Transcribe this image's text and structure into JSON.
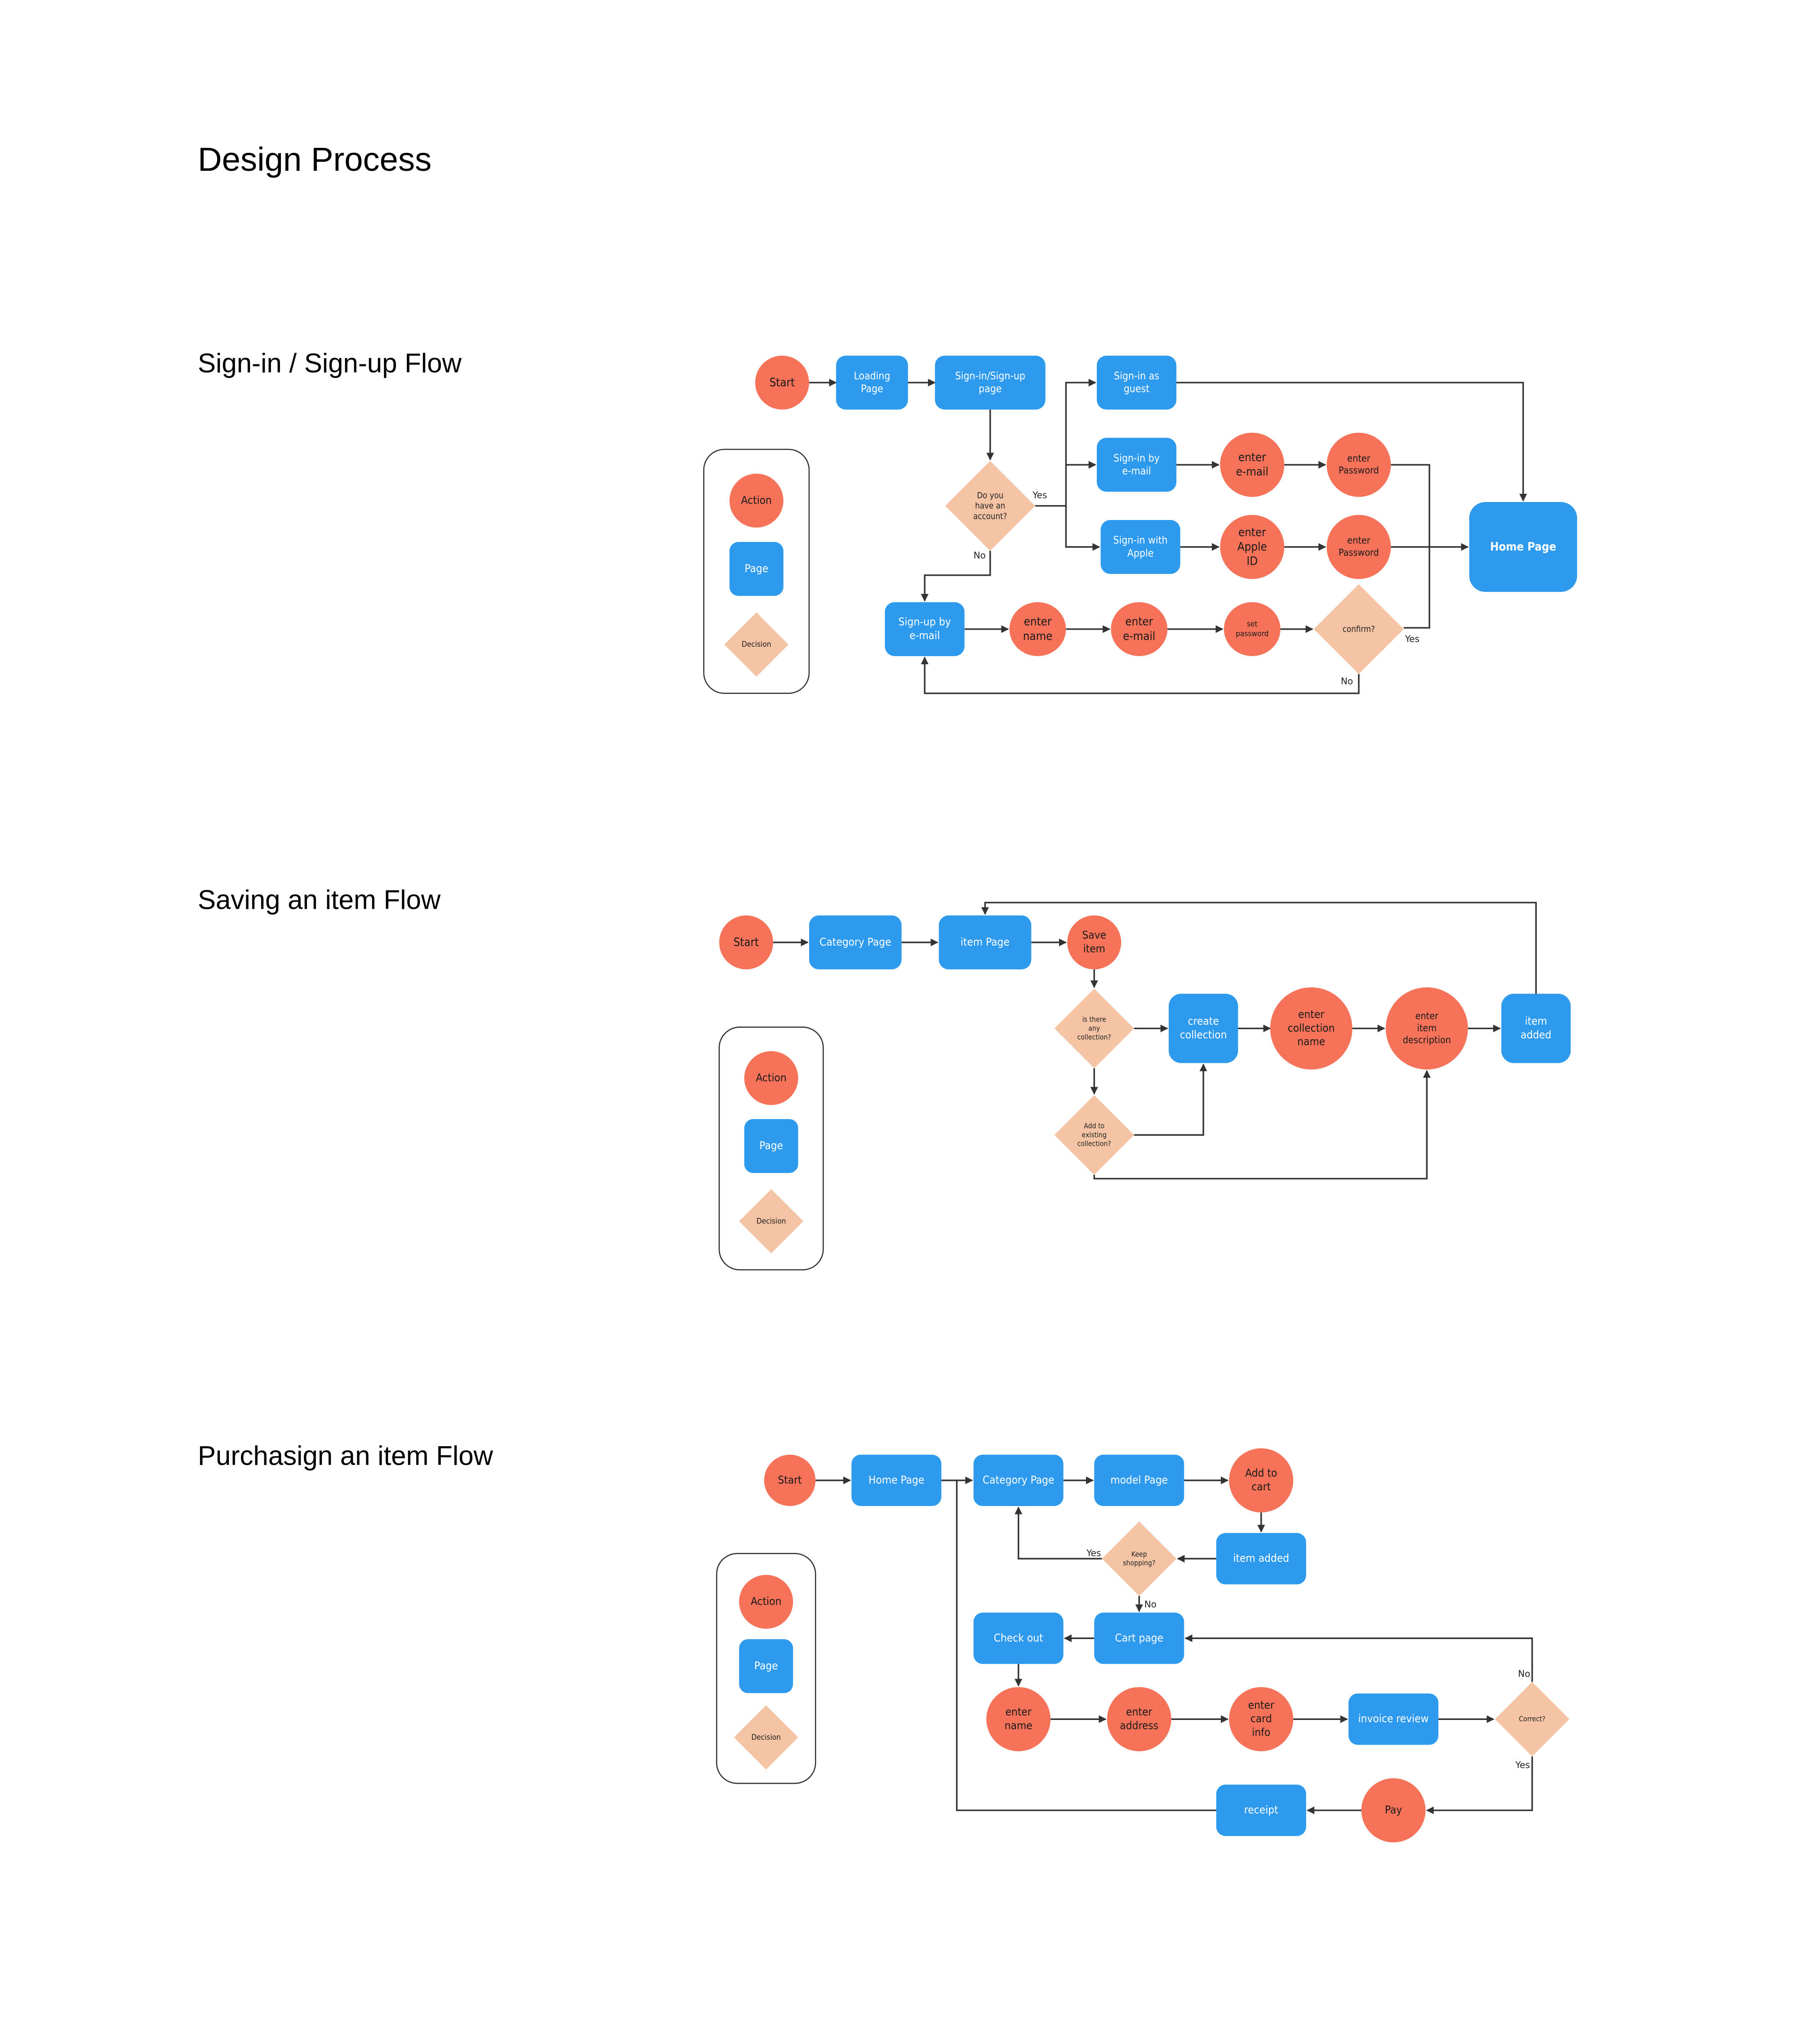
{
  "page": {
    "title": "Design Process"
  },
  "colors": {
    "action": "#F6735A",
    "page": "#2E9AEE",
    "decision": "#F4C4A4",
    "page_text": "#FFFFFF",
    "action_text": "#1A1A1A"
  },
  "legend": {
    "action": "Action",
    "page": "Page",
    "decision": "Decision"
  },
  "flows": [
    {
      "id": "signin",
      "title": "Sign-in / Sign-up Flow",
      "nodes": [
        {
          "id": "start",
          "type": "action",
          "label": "Start"
        },
        {
          "id": "loading",
          "type": "page",
          "label": "Loading\nPage"
        },
        {
          "id": "signinup",
          "type": "page",
          "label": "Sign-in/Sign-up\npage"
        },
        {
          "id": "have_acc",
          "type": "decision",
          "label": "Do you\nhave an\naccount?"
        },
        {
          "id": "guest",
          "type": "page",
          "label": "Sign-in as\nguest"
        },
        {
          "id": "byemail",
          "type": "page",
          "label": "Sign-in by\ne-mail"
        },
        {
          "id": "apple",
          "type": "page",
          "label": "Sign-in with\nApple"
        },
        {
          "id": "enter_email1",
          "type": "action",
          "label": "enter\ne-mail"
        },
        {
          "id": "enter_pw1",
          "type": "action",
          "label": "enter\nPassword"
        },
        {
          "id": "enter_appleid",
          "type": "action",
          "label": "enter\nApple\nID"
        },
        {
          "id": "enter_pw2",
          "type": "action",
          "label": "enter\nPassword"
        },
        {
          "id": "home",
          "type": "page",
          "label": "Home Page"
        },
        {
          "id": "signup",
          "type": "page",
          "label": "Sign-up by\ne-mail"
        },
        {
          "id": "enter_name",
          "type": "action",
          "label": "enter\nname"
        },
        {
          "id": "enter_email2",
          "type": "action",
          "label": "enter\ne-mail"
        },
        {
          "id": "set_pw",
          "type": "action",
          "label": "set\npassword"
        },
        {
          "id": "confirm",
          "type": "decision",
          "label": "confirm?"
        }
      ],
      "edge_labels": {
        "yes1": "Yes",
        "no1": "No",
        "yes2": "Yes",
        "no2": "No"
      }
    },
    {
      "id": "saving",
      "title": "Saving an item Flow",
      "nodes": [
        {
          "id": "start",
          "type": "action",
          "label": "Start"
        },
        {
          "id": "category",
          "type": "page",
          "label": "Category Page"
        },
        {
          "id": "itempage",
          "type": "page",
          "label": "item Page"
        },
        {
          "id": "save",
          "type": "action",
          "label": "Save\nitem"
        },
        {
          "id": "any_coll",
          "type": "decision",
          "label": "is there\nany\ncollection?"
        },
        {
          "id": "add_exist",
          "type": "decision",
          "label": "Add to\nexisting\ncollection?"
        },
        {
          "id": "create",
          "type": "page",
          "label": "create\ncollection"
        },
        {
          "id": "coll_name",
          "type": "action",
          "label": "enter\ncollection\nname"
        },
        {
          "id": "item_desc",
          "type": "action",
          "label": "enter\nitem\ndescription"
        },
        {
          "id": "added",
          "type": "page",
          "label": "item\nadded"
        }
      ],
      "edge_labels": {}
    },
    {
      "id": "purchase",
      "title": "Purchasign an item Flow",
      "nodes": [
        {
          "id": "start",
          "type": "action",
          "label": "Start"
        },
        {
          "id": "home",
          "type": "page",
          "label": "Home Page"
        },
        {
          "id": "category",
          "type": "page",
          "label": "Category Page"
        },
        {
          "id": "model",
          "type": "page",
          "label": "model Page"
        },
        {
          "id": "addcart",
          "type": "action",
          "label": "Add to\ncart"
        },
        {
          "id": "itemadded",
          "type": "page",
          "label": "item added"
        },
        {
          "id": "keep",
          "type": "decision",
          "label": "Keep\nshopping?"
        },
        {
          "id": "cart",
          "type": "page",
          "label": "Cart page"
        },
        {
          "id": "checkout",
          "type": "page",
          "label": "Check out"
        },
        {
          "id": "name",
          "type": "action",
          "label": "enter\nname"
        },
        {
          "id": "address",
          "type": "action",
          "label": "enter\naddress"
        },
        {
          "id": "card",
          "type": "action",
          "label": "enter\ncard\ninfo"
        },
        {
          "id": "invoice",
          "type": "page",
          "label": "invoice review"
        },
        {
          "id": "correct",
          "type": "decision",
          "label": "Correct?"
        },
        {
          "id": "pay",
          "type": "action",
          "label": "Pay"
        },
        {
          "id": "receipt",
          "type": "page",
          "label": "receipt"
        }
      ],
      "edge_labels": {
        "yes1": "Yes",
        "no1": "No",
        "no2": "No",
        "yes2": "Yes"
      }
    }
  ]
}
